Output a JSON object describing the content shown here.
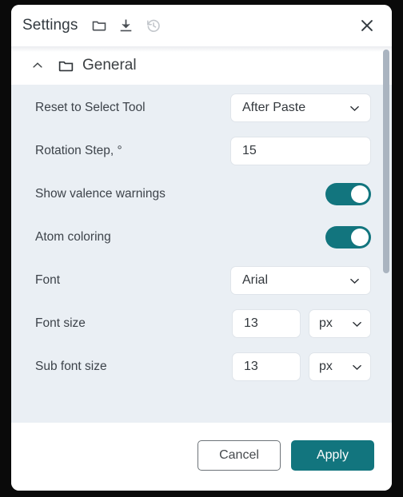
{
  "dialog": {
    "title": "Settings",
    "header_icons": [
      {
        "name": "open-folder-icon",
        "label": "Open from file",
        "disabled": false
      },
      {
        "name": "download-icon",
        "label": "Save to file",
        "disabled": false
      },
      {
        "name": "history-reset-icon",
        "label": "Reset to defaults",
        "disabled": true
      }
    ],
    "close_label": "✕"
  },
  "group": {
    "label": "General",
    "expanded": true,
    "chevron": "^",
    "folder_icon": "folder-icon"
  },
  "rows": [
    {
      "label": "Reset to Select Tool",
      "type": "select",
      "value": "After Paste"
    },
    {
      "label": "Rotation Step, °",
      "type": "text",
      "value": "15"
    },
    {
      "label": "Show valence warnings",
      "type": "toggle",
      "value": "on"
    },
    {
      "label": "Atom coloring",
      "type": "toggle",
      "value": "on"
    },
    {
      "label": "Font",
      "type": "select",
      "value": "Arial"
    },
    {
      "label": "Font size",
      "type": "number-unit",
      "value": "13",
      "unit": "px"
    },
    {
      "label": "Sub font size",
      "type": "number-unit",
      "value": "13",
      "unit": "px"
    }
  ],
  "footer": {
    "cancel_label": "Cancel",
    "apply_label": "Apply"
  },
  "colors": {
    "accent": "#12757e",
    "content_bg": "#eaeff4",
    "panel_bg": "#ffffff",
    "text": "#3d434a",
    "scrollbar": "#aab4c0",
    "disabled_icon": "#c3c7cc"
  },
  "scrollbar": {
    "visible": true
  }
}
